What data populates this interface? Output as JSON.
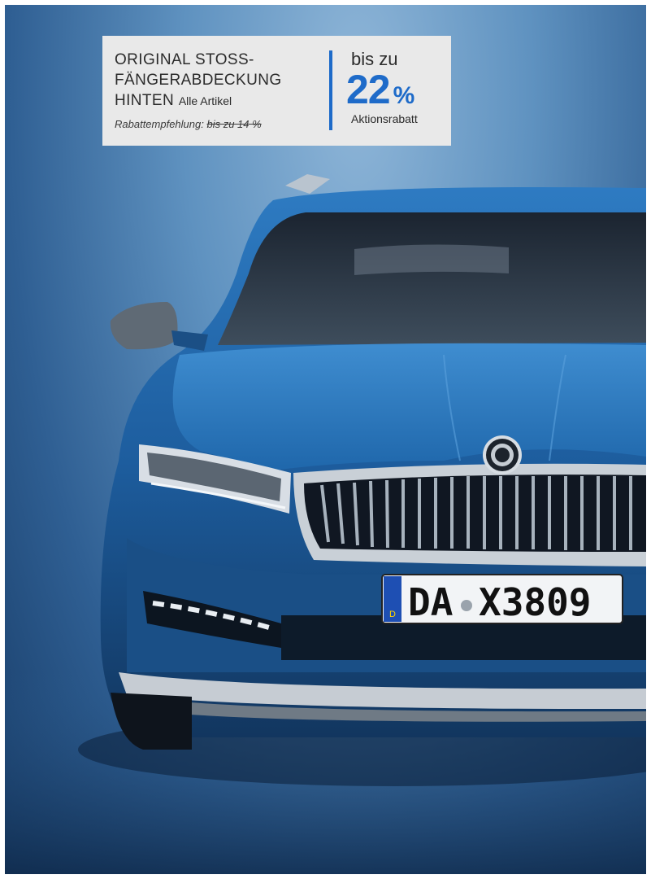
{
  "promo": {
    "title_line1": "ORIGINAL STOSS-",
    "title_line2": "FÄNGERABDECKUNG",
    "title_line3": "HINTEN",
    "title_small": "Alle Artikel",
    "recommendation_label": "Rabattempfehlung:",
    "recommendation_old": "bis zu 14 %",
    "upto": "bis zu",
    "discount_value": "22",
    "discount_unit": "%",
    "discount_caption": "Aktionsrabatt"
  },
  "car": {
    "plate_country": "D",
    "plate_text_left": "DA",
    "plate_text_right": "X3809"
  },
  "colors": {
    "accent": "#1e6bc9",
    "car_body": "#1f5fa0",
    "background_light": "#8fb6d8",
    "background_dark": "#173b66",
    "badge_bg": "#e9e9e9"
  }
}
